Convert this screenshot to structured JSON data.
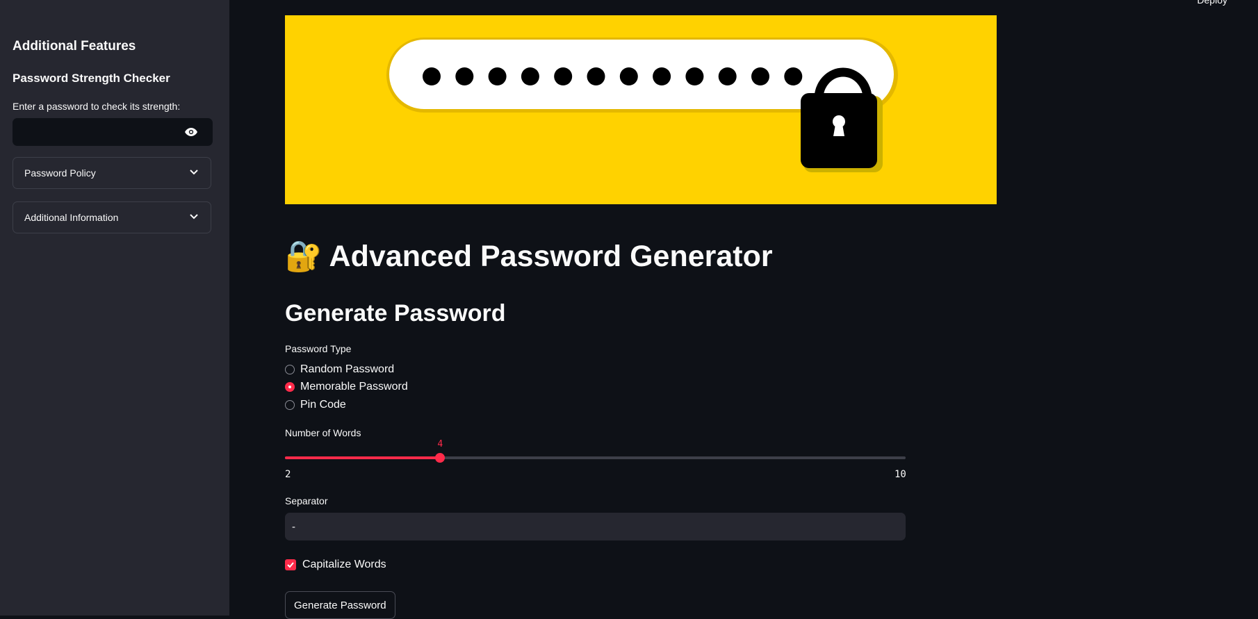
{
  "header": {
    "deploy_label": "Deploy"
  },
  "sidebar": {
    "title": "Additional Features",
    "checker_title": "Password Strength Checker",
    "checker_label": "Enter a password to check its strength:",
    "checker_value": "",
    "expanders": [
      {
        "label": "Password Policy"
      },
      {
        "label": "Additional Information"
      }
    ]
  },
  "banner": {
    "dots_count": 12,
    "icon": "padlock-icon"
  },
  "main": {
    "title_emoji": "🔐",
    "title": "Advanced Password Generator",
    "subheader": "Generate Password",
    "password_type": {
      "label": "Password Type",
      "options": [
        "Random Password",
        "Memorable Password",
        "Pin Code"
      ],
      "selected": "Memorable Password"
    },
    "words": {
      "label": "Number of Words",
      "min": 2,
      "max": 10,
      "value": 4,
      "min_label": "2",
      "max_label": "10",
      "value_label": "4"
    },
    "separator": {
      "label": "Separator",
      "value": "-"
    },
    "capitalize": {
      "label": "Capitalize Words",
      "checked": true
    },
    "generate_button": "Generate Password"
  },
  "colors": {
    "accent": "#ff2b4a",
    "background": "#0e1117",
    "sidebar": "#262730",
    "banner": "#ffd200"
  }
}
